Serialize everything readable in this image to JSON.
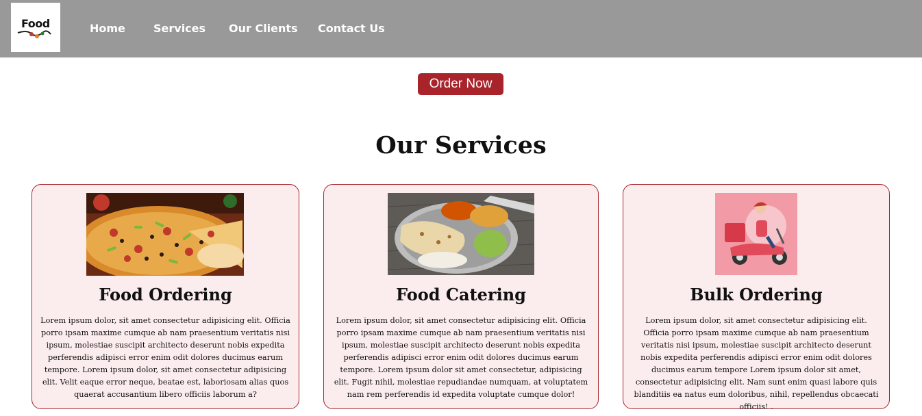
{
  "header": {
    "logo_text": "Food",
    "nav": [
      {
        "label": "Home"
      },
      {
        "label": "Services"
      },
      {
        "label": "Our Clients"
      },
      {
        "label": "Contact Us"
      }
    ]
  },
  "cta": {
    "label": "Order Now"
  },
  "section": {
    "title": "Our Services"
  },
  "cards": [
    {
      "title": "Food Ordering",
      "image": "pizza-photo",
      "description": "Lorem ipsum dolor, sit amet consectetur adipisicing elit. Officia porro ipsam maxime cumque ab nam praesentium veritatis nisi ipsum, molestiae suscipit architecto deserunt nobis expedita perferendis adipisci error enim odit dolores ducimus earum tempore. Lorem ipsum dolor, sit amet consectetur adipisicing elit. Velit eaque error neque, beatae est, laboriosam alias quos quaerat accusantium libero officiis laborum a?"
    },
    {
      "title": "Food Catering",
      "image": "thali-plate-photo",
      "description": "Lorem ipsum dolor, sit amet consectetur adipisicing elit. Officia porro ipsam maxime cumque ab nam praesentium veritatis nisi ipsum, molestiae suscipit architecto deserunt nobis expedita perferendis adipisci error enim odit dolores ducimus earum tempore. Lorem ipsum dolor sit amet consectetur, adipisicing elit. Fugit nihil, molestiae repudiandae numquam, at voluptatem nam rem perferendis id expedita voluptate cumque dolor!"
    },
    {
      "title": "Bulk Ordering",
      "image": "delivery-scooter-illustration",
      "description": "Lorem ipsum dolor, sit amet consectetur adipisicing elit. Officia porro ipsam maxime cumque ab nam praesentium veritatis nisi ipsum, molestiae suscipit architecto deserunt nobis expedita perferendis adipisci error enim odit dolores ducimus earum tempore Lorem ipsum dolor sit amet, consectetur adipisicing elit. Nam sunt enim quasi labore quis blanditiis ea natus eum doloribus, nihil, repellendus obcaecati officiis! ."
    }
  ],
  "colors": {
    "navbar": "#999999",
    "accent": "#a8232a",
    "card_bg": "#fbeced"
  }
}
